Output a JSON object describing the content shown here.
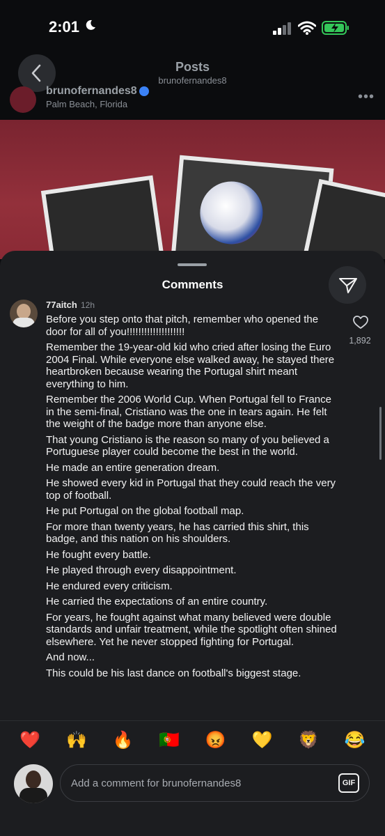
{
  "status": {
    "time": "2:01"
  },
  "post_header": {
    "title": "Posts",
    "subtitle": "brunofernandes8",
    "username": "brunofernandes8",
    "location": "Palm Beach, Florida",
    "more": "•••"
  },
  "comments": {
    "title": "Comments",
    "items": [
      {
        "username": "77aitch",
        "time": "12h",
        "likes": "1,892",
        "paragraphs": [
          "Before you step onto that pitch, remember who opened the door for all of you!!!!!!!!!!!!!!!!!!!!",
          "Remember the 19-year-old kid who cried after losing the Euro 2004 Final. While everyone else walked away, he stayed there heartbroken because wearing the Portugal shirt meant everything to him.",
          "Remember the 2006 World Cup. When Portugal fell to France in the semi-final, Cristiano was the one in tears again. He felt the weight of the badge more than anyone else.",
          "That young Cristiano is the reason so many of you believed a Portuguese player could become the best in the world.",
          "He made an entire generation dream.",
          "He showed every kid in Portugal that they could reach the very top of football.",
          "He put Portugal on the global football map.",
          "For more than twenty years, he has carried this shirt, this badge, and this nation on his shoulders.",
          "He fought every battle.",
          "He played through every disappointment.",
          "He endured every criticism.",
          "He carried the expectations of an entire country.",
          "For years, he fought against what many believed were double standards and unfair treatment, while the spotlight often shined elsewhere. Yet he never stopped fighting for Portugal.",
          "And now...",
          "This could be his last dance on football's biggest stage."
        ]
      }
    ]
  },
  "emoji_bar": [
    "❤️",
    "🙌",
    "🔥",
    "🇵🇹",
    "😡",
    "💛",
    "🦁",
    "😂"
  ],
  "composer": {
    "placeholder": "Add a comment for brunofernandes8",
    "gif_label": "GIF"
  }
}
